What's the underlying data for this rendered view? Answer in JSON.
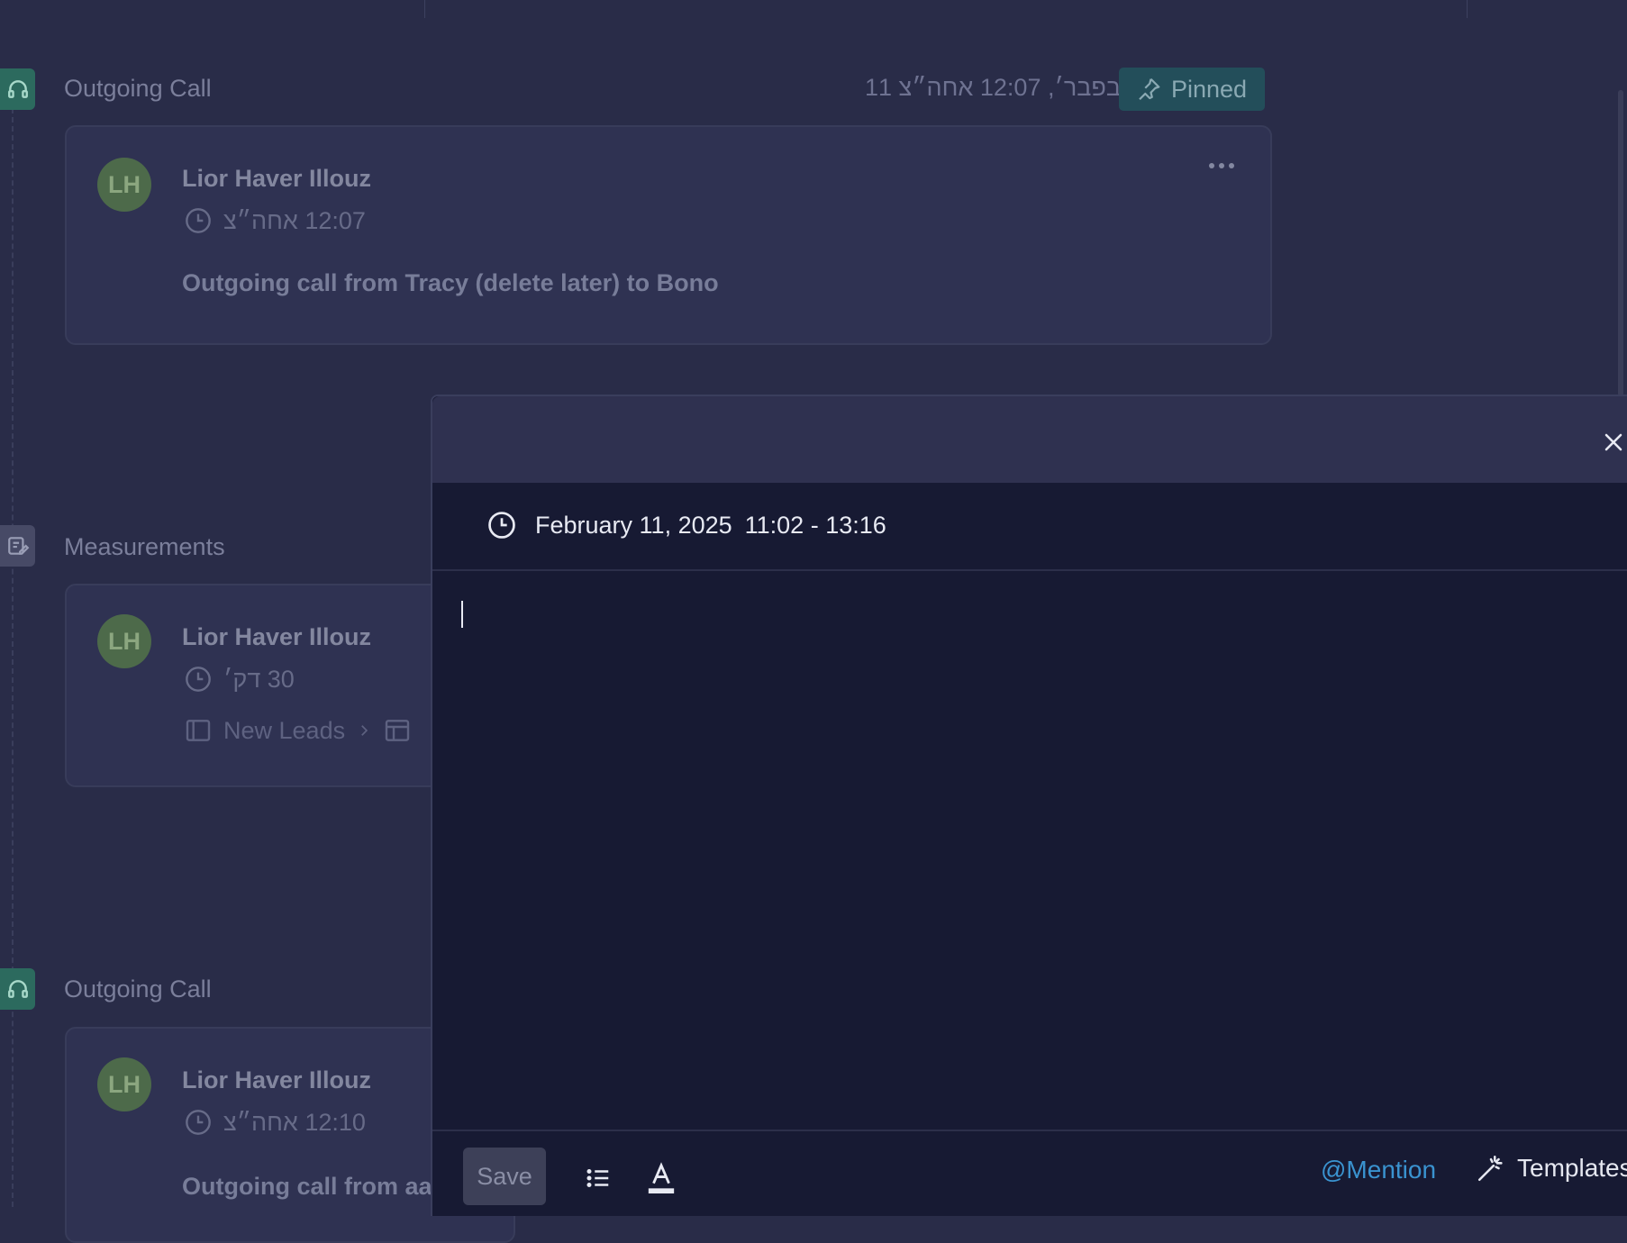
{
  "events": [
    {
      "type": "call",
      "title": "Outgoing Call",
      "time": "בפבר׳, 12:07 אחה״צ 11",
      "pinned_label": "Pinned",
      "author": "Lior Haver Illouz",
      "avatar_initials": "LH",
      "meta": "12:07 אחה״צ",
      "body": "Outgoing call from Tracy (delete later) to Bono"
    },
    {
      "type": "note",
      "title": "Measurements",
      "author": "Lior Haver Illouz",
      "avatar_initials": "LH",
      "meta": "30 דק׳",
      "crumb_board": "New Leads"
    },
    {
      "type": "call",
      "title": "Outgoing Call",
      "author": "Lior Haver Illouz",
      "avatar_initials": "LH",
      "meta": "12:10 אחה״צ",
      "body": "Outgoing call from aa"
    }
  ],
  "modal": {
    "date": "February 11, 2025",
    "time_range": "11:02 - 13:16",
    "save_label": "Save",
    "mention_label": "@Mention",
    "templates_label": "Templates"
  }
}
